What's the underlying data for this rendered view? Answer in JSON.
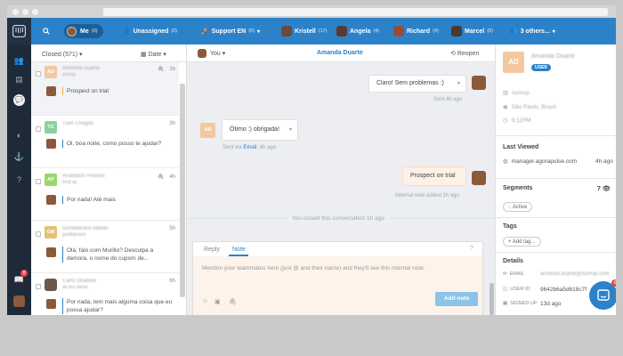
{
  "topnav": {
    "me": {
      "label": "Me",
      "count": "(0)"
    },
    "unassigned": {
      "label": "Unassigned",
      "count": "(0)"
    },
    "support": {
      "label": "Support EN",
      "count": "(5)"
    },
    "kristell": {
      "label": "Kristell",
      "count": "(17)"
    },
    "angela": {
      "label": "Angela",
      "count": "(4)"
    },
    "richard": {
      "label": "Richard",
      "count": "(4)"
    },
    "marcel": {
      "label": "Marcel",
      "count": "(0)"
    },
    "others": {
      "label": "3 others..."
    }
  },
  "list": {
    "filter_label": "Closed (571)",
    "sort_label": "Date",
    "rows": [
      {
        "initials": "AD",
        "name": "Amanda Duarte",
        "sub": "sumup",
        "time": "1h",
        "msg": "Prospect on trial"
      },
      {
        "initials": "TC",
        "name": "Tulio Chagas",
        "sub": "",
        "time": "3h",
        "msg": "Oi, boa noite, como posso te ajudar?"
      },
      {
        "initials": "AP",
        "name": "Anastácio Passos",
        "sub": "lend.ag",
        "time": "4h",
        "msg": "Por nada! Até mais"
      },
      {
        "initials": "GM",
        "name": "Gorillabrand Midias",
        "sub": "gorillabrand",
        "time": "5h",
        "msg": "Olá, falo com Murillo? Desculpa a demora, o nome do cupom de..."
      },
      {
        "initials": "",
        "name": "Carol Strabelli",
        "sub": "all das ideias",
        "time": "6h",
        "msg": "Por nada, tem mais alguma coisa que eu possa ajudar?"
      }
    ]
  },
  "conversation": {
    "assignee": "You",
    "contact": "Amanda Duarte",
    "reopen_label": "Reopen",
    "messages": [
      {
        "text": "Claro! Sem problemas :)",
        "meta": "Sent 4h ago"
      },
      {
        "initials": "AD",
        "text": "Ótimo :) obrigada!",
        "meta_prefix": "Sent via",
        "meta_link": "Email",
        "meta_suffix": ", 4h ago"
      },
      {
        "text": "Prospect on trial",
        "meta_prefix": "Internal note",
        "meta_link": "added",
        "meta_suffix": "1h ago"
      }
    ],
    "closed_text_prefix": "You",
    "closed_text_link": "closed this conversation",
    "closed_text_suffix": "1h ago"
  },
  "composer": {
    "tab_reply": "Reply",
    "tab_note": "Note",
    "placeholder": "Mention your teammates here (just @ and their name) and they'll see this internal note.",
    "add_note_label": "Add note"
  },
  "details": {
    "initials": "AD",
    "name": "Amanda Duarte",
    "user_badge": "USER",
    "company": "sumup",
    "location": "São Paulo, Brazil",
    "local_time": "9:11PM",
    "last_viewed_title": "Last Viewed",
    "last_viewed_url": "manager.agorapulse.com",
    "last_viewed_time": "4h ago",
    "segments_title": "Segments",
    "segments_count": "7",
    "segment_active": "Active",
    "tags_title": "Tags",
    "add_tag_label": "+ Add tag...",
    "details_title": "Details",
    "email_label": "EMAIL",
    "email_value": "amanda.duarte@sumup.com",
    "user_id_label": "USER ID",
    "user_id_value": "9642b6a5d618c7f",
    "signed_up_label": "SIGNED UP",
    "signed_up_value": "13d ago"
  },
  "sidebar": {
    "badge_count": "8"
  },
  "chat_badge": "6",
  "colors": {
    "brand": "#2c82c9",
    "sidebar": "#1e2a38"
  }
}
